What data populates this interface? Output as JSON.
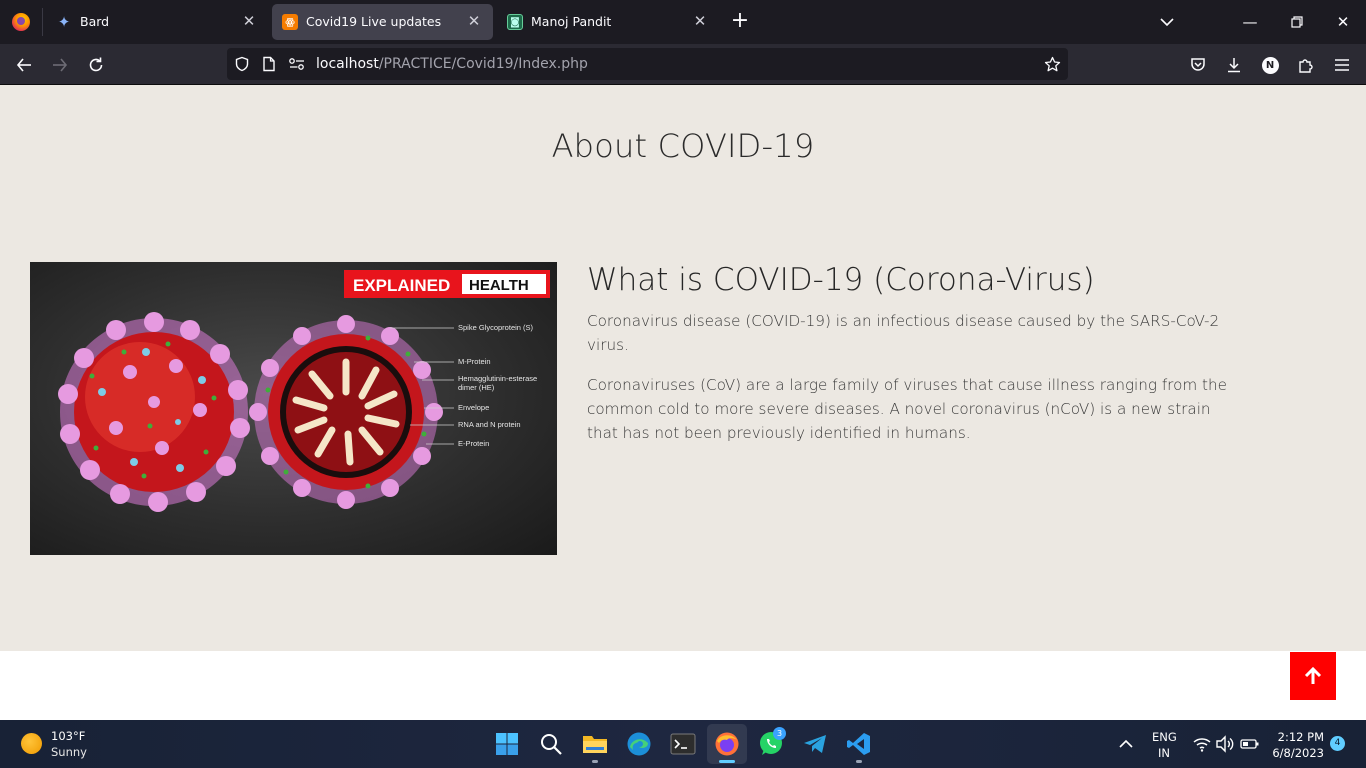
{
  "browser": {
    "tabs": [
      {
        "title": "Bard",
        "favicon": "bard-sparkle-icon",
        "active": false
      },
      {
        "title": "Covid19 Live updates",
        "favicon": "xampp-icon",
        "active": true
      },
      {
        "title": "Manoj Pandit",
        "favicon": "site-icon",
        "active": false
      }
    ],
    "url_host": "localhost",
    "url_path": "/PRACTICE/Covid19/Index.php",
    "profile_initial": "N"
  },
  "page": {
    "section_title": "About COVID-19",
    "image": {
      "badge_left": "EXPLAINED",
      "badge_right": "HEALTH",
      "labels": [
        "Spike Glycoprotein (S)",
        "M-Protein",
        "Hemagglutinin-esterase",
        "dimer (HE)",
        "Envelope",
        "RNA and N protein",
        "E-Protein"
      ]
    },
    "heading": "What is COVID-19 (Corona-Virus)",
    "paragraph1": "Coronavirus disease (COVID-19) is an infectious disease caused by the SARS-CoV-2 virus.",
    "paragraph2": "Coronaviruses (CoV) are a large family of viruses that cause illness ranging from the common cold to more severe diseases. A novel coronavirus (nCoV) is a new strain that has not been previously identified in humans.",
    "scroll_top_icon": "arrow-up-icon",
    "accent_color": "#ff0000"
  },
  "taskbar": {
    "weather_temp": "103°F",
    "weather_desc": "Sunny",
    "whatsapp_badge": "3",
    "lang_line1": "ENG",
    "lang_line2": "IN",
    "time": "2:12 PM",
    "date": "6/8/2023",
    "notification_count": "4"
  }
}
